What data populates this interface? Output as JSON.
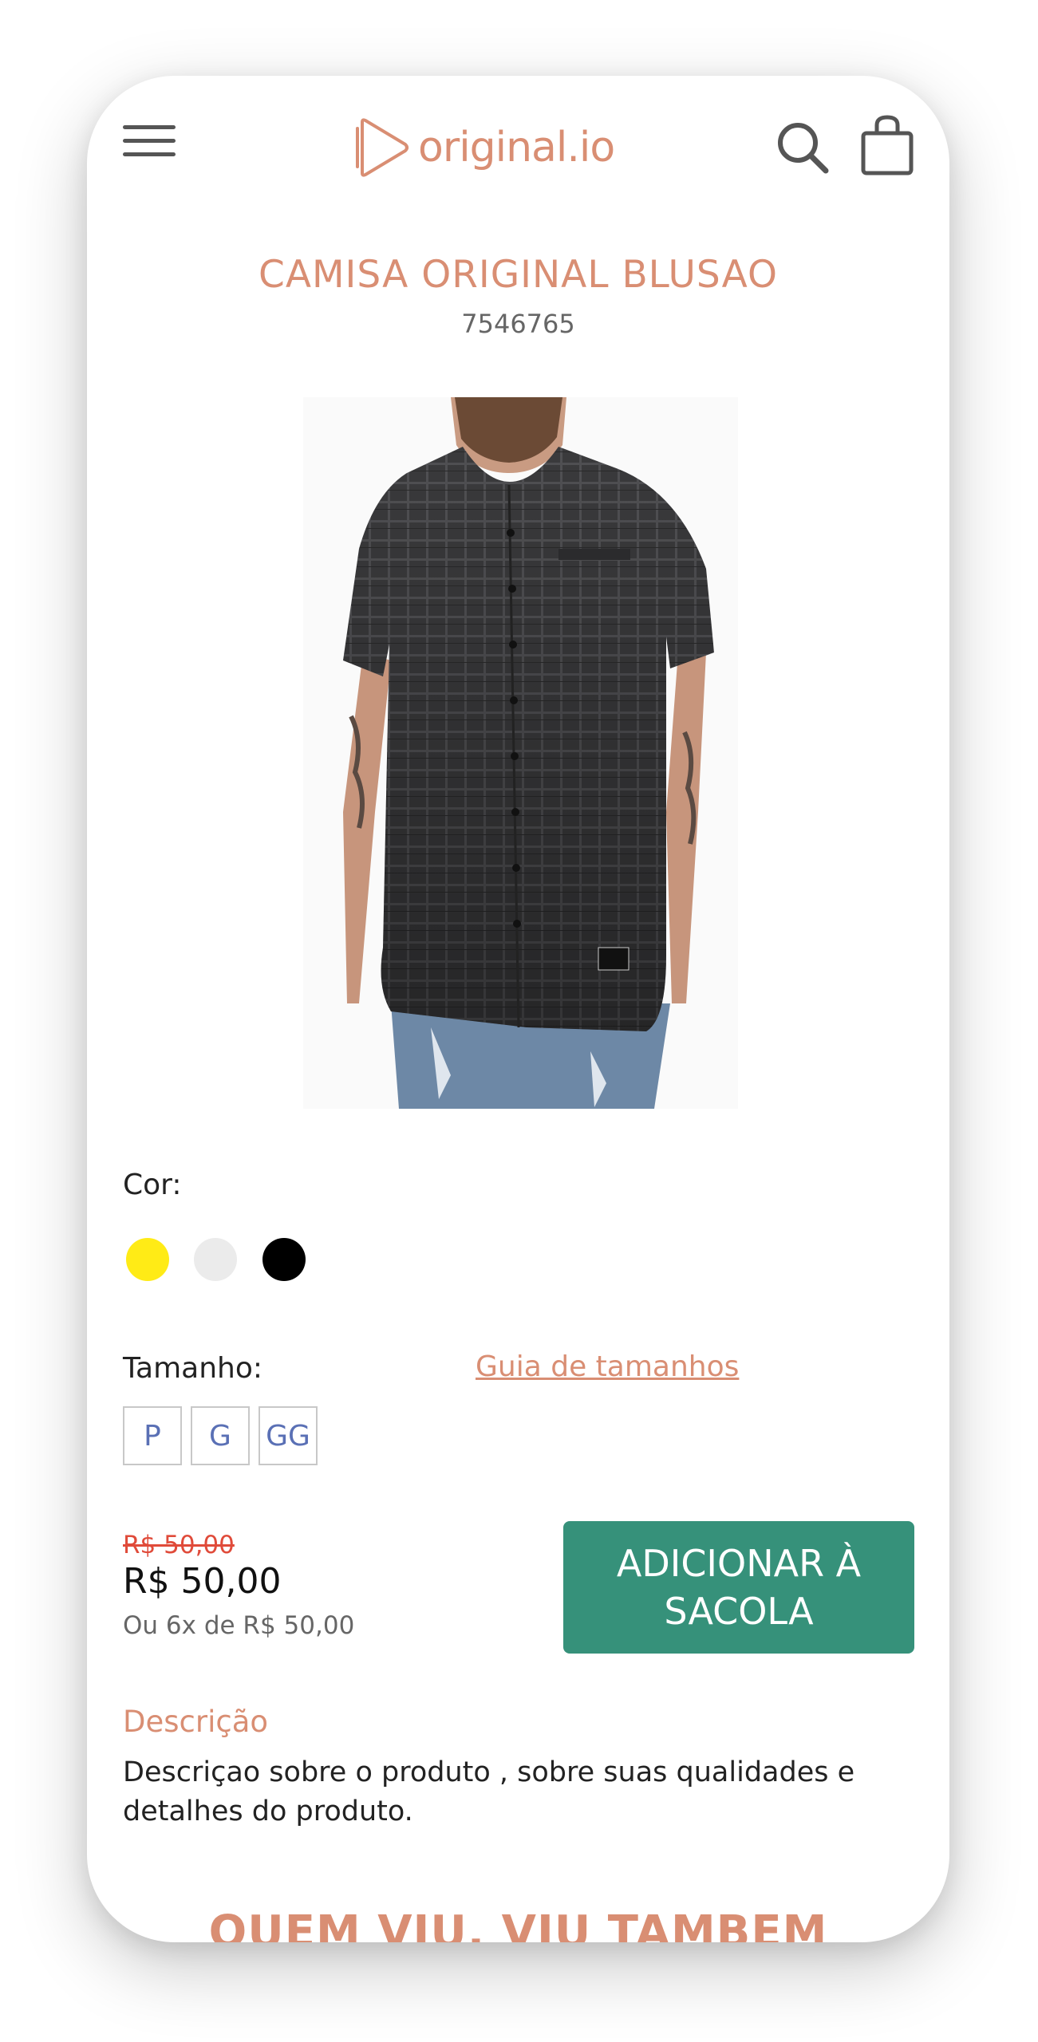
{
  "header": {
    "logo_text": "original.io",
    "icons": [
      "menu-icon",
      "search-icon",
      "shopping-bag-icon"
    ]
  },
  "product": {
    "title": "CAMISA ORIGINAL BLUSAO",
    "sku": "7546765",
    "image_description": "man wearing dark plaid button-up short-sleeve shirt"
  },
  "color": {
    "label": "Cor:",
    "options": [
      {
        "name": "yellow",
        "hex": "#ffeb16"
      },
      {
        "name": "light-gray",
        "hex": "#ebebeb"
      },
      {
        "name": "black",
        "hex": "#000000"
      }
    ]
  },
  "size": {
    "label": "Tamanho:",
    "guide_link": "Guia de tamanhos",
    "options": [
      "P",
      "G",
      "GG"
    ]
  },
  "pricing": {
    "old_price": "R$ 50,00",
    "price": "R$ 50,00",
    "installments": "Ou 6x de R$ 50,00"
  },
  "cta": {
    "add_to_bag": "ADICIONAR À SACOLA"
  },
  "description": {
    "heading": "Descrição",
    "text": "Descriçao sobre o produto , sobre suas qualidades e detalhes do produto."
  },
  "related": {
    "heading": "QUEM VIU, VIU TAMBEM"
  },
  "colors": {
    "accent": "#d98e73",
    "button": "#36917a",
    "strike_price": "#e04b3a",
    "size_text": "#5a70b5"
  }
}
